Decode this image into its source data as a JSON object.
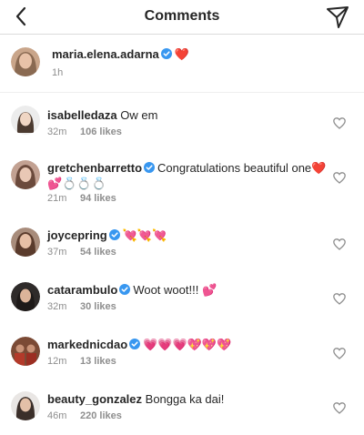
{
  "header": {
    "title": "Comments"
  },
  "caption": {
    "username": "maria.elena.adarna",
    "emoji": "❤️",
    "time": "1h",
    "avatar_color": "#8a6a52"
  },
  "comments": [
    {
      "username": "isabelledaza",
      "verified": false,
      "text": "Ow em",
      "time": "32m",
      "likes": "106 likes",
      "avatar_color": "#d9d4cf"
    },
    {
      "username": "gretchenbarretto",
      "verified": true,
      "text": "Congratulations beautiful one",
      "text_emoji": "❤️",
      "line2_emoji": "💕💍💍💍",
      "time": "21m",
      "likes": "94 likes",
      "avatar_color": "#6b4a3c"
    },
    {
      "username": "joycepring",
      "verified": true,
      "text": "",
      "text_emoji": "💘💘💘",
      "time": "37m",
      "likes": "54 likes",
      "avatar_color": "#5a3b2c"
    },
    {
      "username": "catarambulo",
      "verified": true,
      "text": "Woot woot!!!",
      "text_emoji": "💕",
      "time": "32m",
      "likes": "30 likes",
      "avatar_color": "#3f3b3a"
    },
    {
      "username": "markednicdao",
      "verified": true,
      "text": "",
      "text_emoji": "💗💗💗💖💖💖",
      "time": "12m",
      "likes": "13 likes",
      "avatar_color": "#6e3b2a"
    },
    {
      "username": "beauty_gonzalez",
      "verified": false,
      "text": "Bongga ka dai!",
      "time": "46m",
      "likes": "220 likes",
      "avatar_color": "#7a6a64"
    }
  ],
  "colors": {
    "verified": "#3897f0",
    "muted": "#8e8e8e",
    "text": "#262626"
  }
}
